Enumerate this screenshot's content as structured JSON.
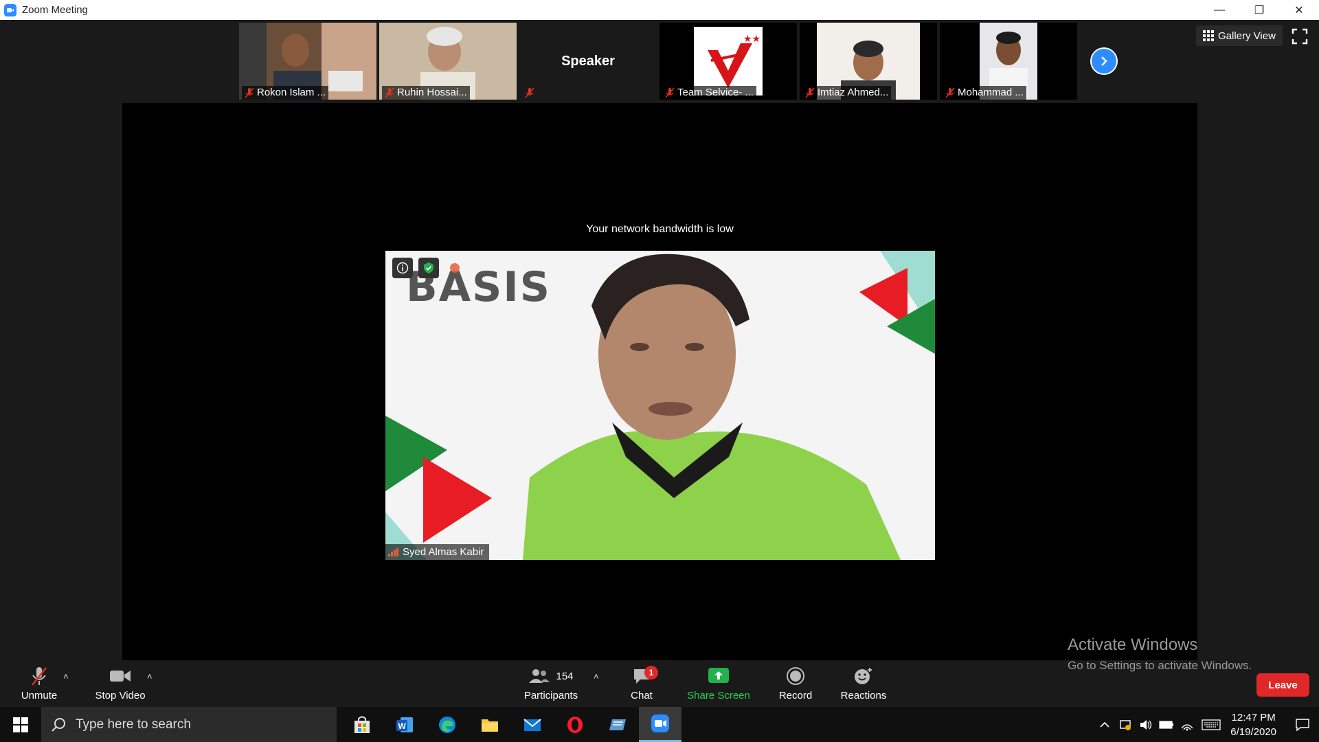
{
  "window": {
    "title": "Zoom Meeting"
  },
  "participants_strip": [
    {
      "name": "Rokon Islam ...",
      "kind": "video"
    },
    {
      "name": "Ruhin Hossai...",
      "kind": "video"
    },
    {
      "name": "",
      "kind": "speaker",
      "label": "Speaker"
    },
    {
      "name": "Team Selvice- ...",
      "kind": "logo"
    },
    {
      "name": "Imtiaz Ahmed...",
      "kind": "video"
    },
    {
      "name": "Mohammad ...",
      "kind": "video"
    }
  ],
  "view": {
    "gallery_label": "Gallery View"
  },
  "main": {
    "bandwidth_message": "Your network bandwidth is low",
    "active_speaker": "Syed Almas Kabir",
    "backdrop_text": "BASIS"
  },
  "watermark": {
    "title": "Activate Windows",
    "subtitle": "Go to Settings to activate Windows."
  },
  "toolbar": {
    "unmute": "Unmute",
    "stop_video": "Stop Video",
    "participants": "Participants",
    "participant_count": "154",
    "chat": "Chat",
    "chat_badge": "1",
    "share_screen": "Share Screen",
    "record": "Record",
    "reactions": "Reactions",
    "leave": "Leave"
  },
  "taskbar": {
    "search_placeholder": "Type here to search",
    "time": "12:47 PM",
    "date": "6/19/2020"
  },
  "colors": {
    "accent": "#2d8cff",
    "leave": "#e02828",
    "share": "#22b14c"
  }
}
